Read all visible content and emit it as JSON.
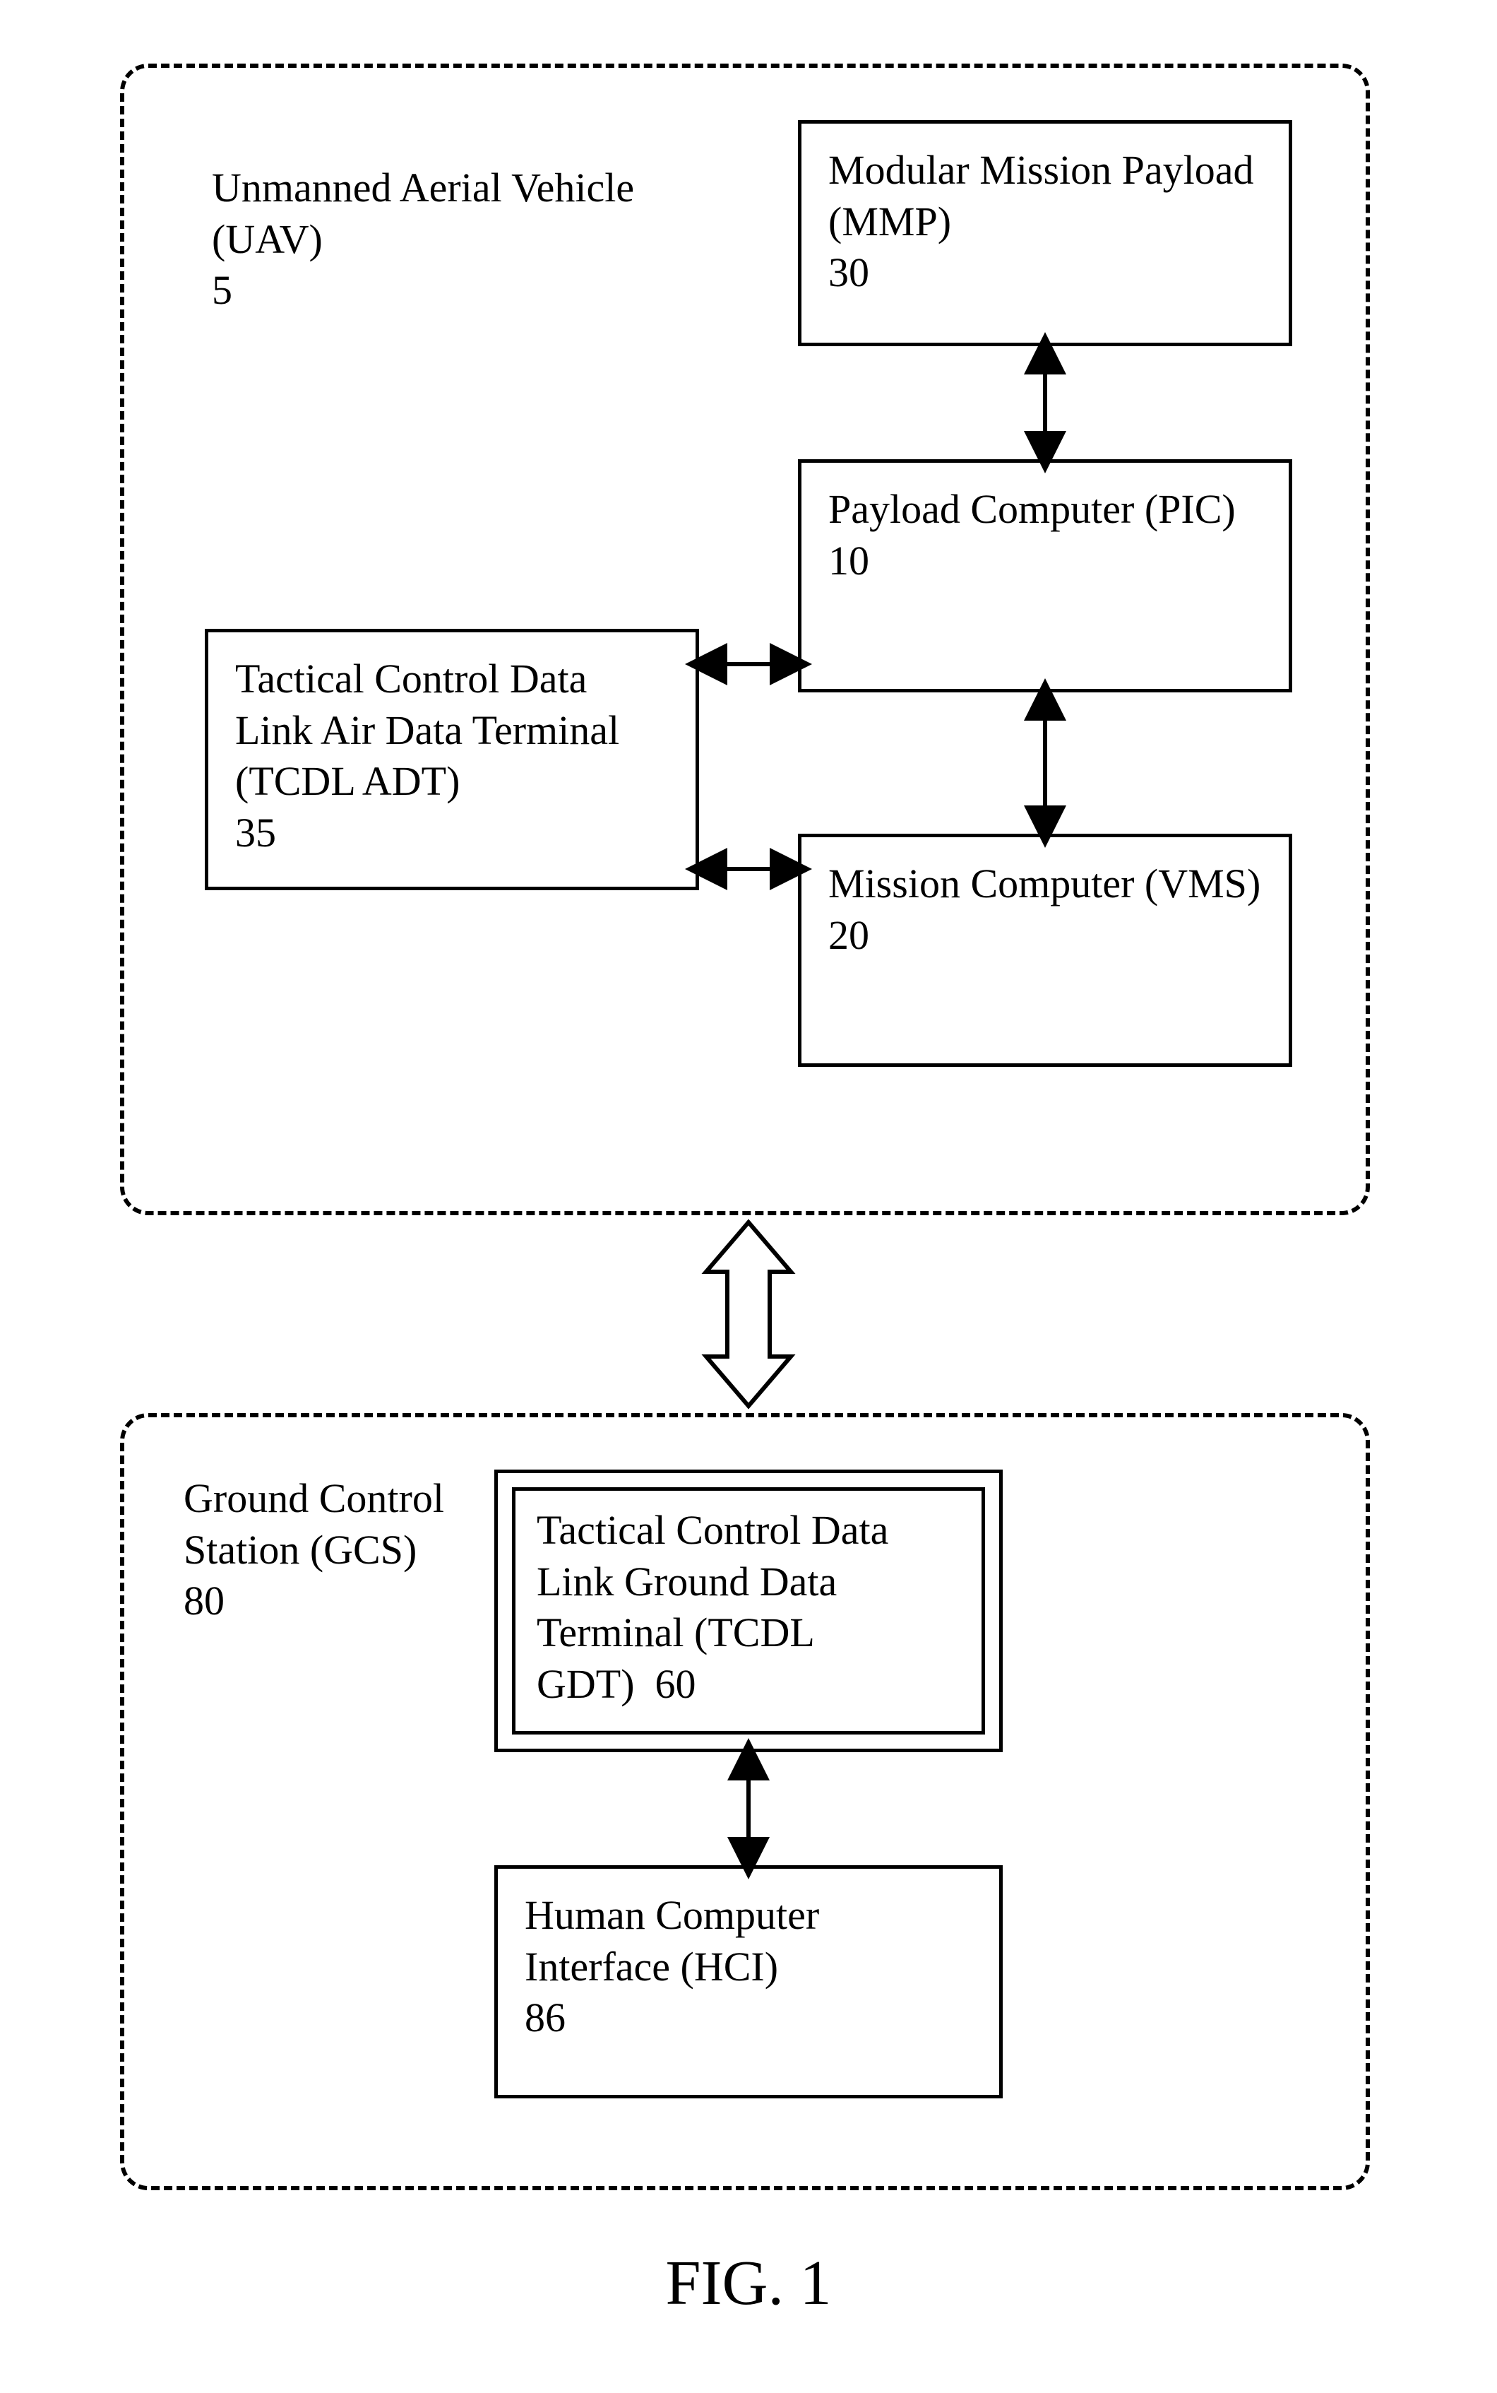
{
  "figureLabel": "FIG. 1",
  "uav": {
    "title": "Unmanned Aerial Vehicle (UAV)",
    "ref": "5",
    "mmp": {
      "title": "Modular Mission Payload (MMP)",
      "ref": "30"
    },
    "pic": {
      "title": "Payload Computer (PIC)",
      "ref": "10"
    },
    "tcdl": {
      "title": "Tactical Control Data Link Air Data Terminal (TCDL ADT)",
      "ref": "35"
    },
    "vms": {
      "title": "Mission Computer (VMS)",
      "ref": "20"
    }
  },
  "gcs": {
    "title": "Ground Control Station (GCS)",
    "ref": "80",
    "gdt": {
      "title": "Tactical Control Data Link Ground Data Terminal (TCDL GDT)",
      "ref": "60"
    },
    "hci": {
      "title": "Human Computer Interface (HCI)",
      "ref": "86"
    }
  }
}
